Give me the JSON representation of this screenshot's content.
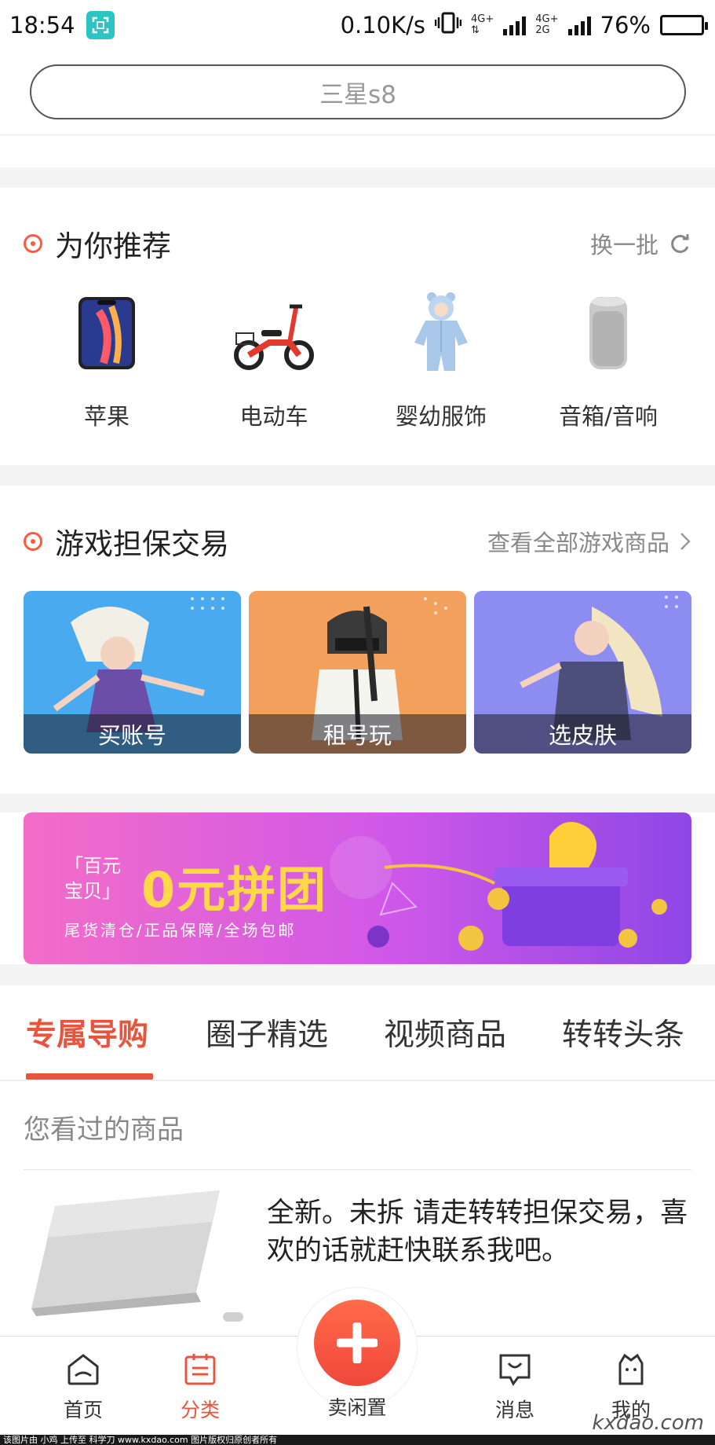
{
  "status_bar": {
    "time": "18:54",
    "speed": "0.10K/s",
    "net1": "4G+",
    "net2_top": "4G+",
    "net2_bottom": "2G",
    "battery": "76%",
    "battery_level": 0.76
  },
  "search": {
    "placeholder": "三星s8"
  },
  "recommend": {
    "title": "为你推荐",
    "refresh_label": "换一批",
    "items": [
      {
        "label": "苹果",
        "icon": "phone-icon"
      },
      {
        "label": "电动车",
        "icon": "ebike-icon"
      },
      {
        "label": "婴幼服饰",
        "icon": "baby-clothes-icon"
      },
      {
        "label": "音箱/音响",
        "icon": "speaker-icon"
      }
    ]
  },
  "games": {
    "title": "游戏担保交易",
    "view_all": "查看全部游戏商品",
    "cards": [
      {
        "label": "买账号",
        "color": "#4aaaf0"
      },
      {
        "label": "租号玩",
        "color": "#f3a05c"
      },
      {
        "label": "选皮肤",
        "color": "#8d8cf0"
      }
    ]
  },
  "banner": {
    "small_text_1": "「百元",
    "small_text_2": "宝贝」",
    "big_text": "0元拼团",
    "sub_text": "尾货清仓/正品保障/全场包邮"
  },
  "tabs": [
    {
      "label": "专属导购",
      "active": true
    },
    {
      "label": "圈子精选",
      "active": false
    },
    {
      "label": "视频商品",
      "active": false
    },
    {
      "label": "转转头条",
      "active": false
    }
  ],
  "viewed": {
    "title": "您看过的商品",
    "product_desc": "全新。未拆 请走转转担保交易，喜欢的话就赶快联系我吧。"
  },
  "bottom_nav": {
    "home": "首页",
    "category": "分类",
    "sell": "卖闲置",
    "messages": "消息",
    "mine": "我的"
  },
  "watermark": {
    "strip": "该图片由 小鸡 上传至 科学刀 www.kxdao.com 图片版权归原创者所有",
    "logo": "kxdao.com"
  },
  "colors": {
    "accent": "#e8553e",
    "search_border": "#555555"
  }
}
